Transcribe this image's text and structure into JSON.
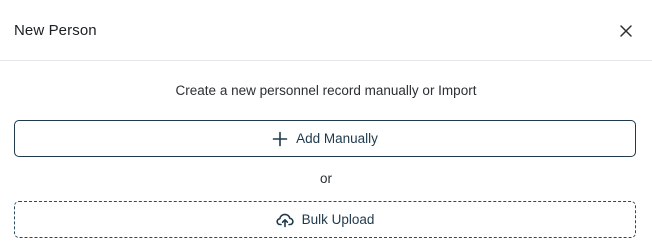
{
  "dialog": {
    "title": "New Person",
    "close_icon": "close-icon",
    "subtitle": "Create a new personnel record manually or Import",
    "add_manually": {
      "label": "Add Manually",
      "icon": "plus-icon"
    },
    "separator": "or",
    "bulk_upload": {
      "label": "Bulk Upload",
      "icon": "cloud-upload-icon"
    }
  },
  "colors": {
    "accent": "#1f3a4d",
    "divider": "#e6e8eb",
    "text": "#1b1f24"
  }
}
